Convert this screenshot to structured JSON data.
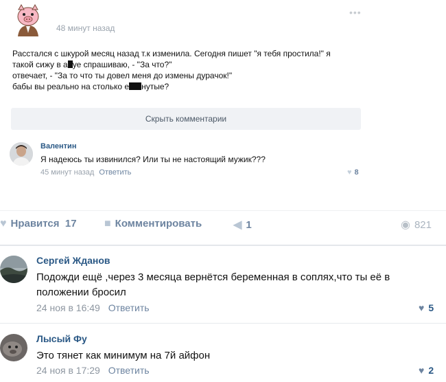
{
  "post": {
    "time": "48 минут назад",
    "text_lines": [
      "Расстался с шкурой месяц назад т.к изменила. Сегодня пишет \"я тебя простила!\" я",
      [
        "такой сижу в а",
        "уе спрашиваю, - \"За что?\""
      ],
      "отвечает, - \"За то что ты довел меня до измены дурачок!\"",
      [
        "бабы вы реально на столько е",
        "нутые?"
      ]
    ],
    "hide_comments_label": "Скрыть комментарии",
    "inner_comment": {
      "author": "Валентин",
      "text": "Я надеюсь ты извинился? Или ты не настоящий мужик???",
      "time": "45 минут назад",
      "reply_label": "Ответить",
      "likes": "8"
    }
  },
  "actions": {
    "like_label": "Нравится",
    "like_count": "17",
    "comment_label": "Комментировать",
    "share_count": "1",
    "views_count": "821"
  },
  "comments": [
    {
      "author": "Сергей Жданов",
      "text": "Подожди ещё ,через 3 месяца вернётся беременная в соплях,что ты её в положении бросил",
      "date": "24 ноя в 16:49",
      "reply_label": "Ответить",
      "likes": "5"
    },
    {
      "author": "Лысый Фу",
      "text": "Это тянет как минимум на 7й айфон",
      "date": "24 ноя в 17:29",
      "reply_label": "Ответить",
      "likes": "2"
    }
  ],
  "icons": {
    "post_avatar": "pig-avatar-icon",
    "more": "more-dots-icon",
    "like": "heart-icon",
    "comment": "speech-bubble-icon",
    "share": "megaphone-icon",
    "views": "eye-icon"
  },
  "colors": {
    "link": "#2a5885",
    "muted": "#9aa3ad",
    "action": "#6d84a0"
  }
}
